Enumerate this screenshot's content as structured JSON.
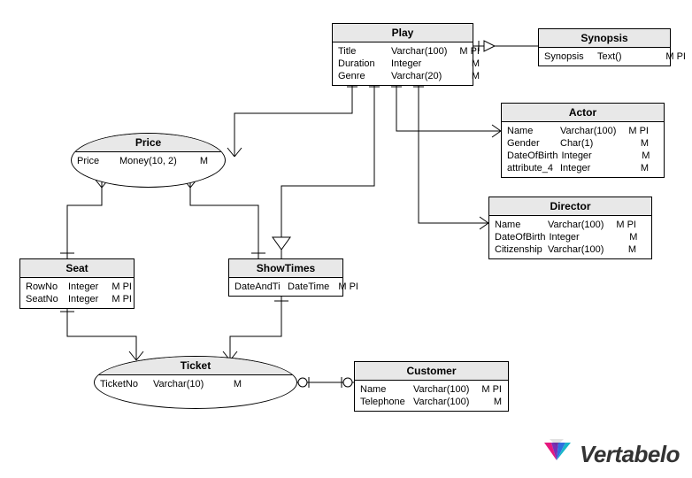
{
  "entities": {
    "play": {
      "title": "Play",
      "rows": [
        {
          "name": "Title",
          "type": "Varchar(100)",
          "flags": "M PI"
        },
        {
          "name": "Duration",
          "type": "Integer",
          "flags": "M"
        },
        {
          "name": "Genre",
          "type": "Varchar(20)",
          "flags": "M"
        }
      ]
    },
    "synopsis": {
      "title": "Synopsis",
      "rows": [
        {
          "name": "Synopsis",
          "type": "Text()",
          "flags": "M PI"
        }
      ]
    },
    "actor": {
      "title": "Actor",
      "rows": [
        {
          "name": "Name",
          "type": "Varchar(100)",
          "flags": "M PI"
        },
        {
          "name": "Gender",
          "type": "Char(1)",
          "flags": "M"
        },
        {
          "name": "DateOfBirth",
          "type": "Integer",
          "flags": "M"
        },
        {
          "name": "attribute_4",
          "type": "Integer",
          "flags": "M"
        }
      ]
    },
    "director": {
      "title": "Director",
      "rows": [
        {
          "name": "Name",
          "type": "Varchar(100)",
          "flags": "M PI"
        },
        {
          "name": "DateOfBirth",
          "type": "Integer",
          "flags": "M"
        },
        {
          "name": "Citizenship",
          "type": "Varchar(100)",
          "flags": "M"
        }
      ]
    },
    "price": {
      "title": "Price",
      "rows": [
        {
          "name": "Price",
          "type": "Money(10, 2)",
          "flags": "M"
        }
      ]
    },
    "seat": {
      "title": "Seat",
      "rows": [
        {
          "name": "RowNo",
          "type": "Integer",
          "flags": "M PI"
        },
        {
          "name": "SeatNo",
          "type": "Integer",
          "flags": "M PI"
        }
      ]
    },
    "showtimes": {
      "title": "ShowTimes",
      "rows": [
        {
          "name": "DateAndTi",
          "type": "DateTime",
          "flags": "M PI"
        }
      ]
    },
    "ticket": {
      "title": "Ticket",
      "rows": [
        {
          "name": "TicketNo",
          "type": "Varchar(10)",
          "flags": "M"
        }
      ]
    },
    "customer": {
      "title": "Customer",
      "rows": [
        {
          "name": "Name",
          "type": "Varchar(100)",
          "flags": "M PI"
        },
        {
          "name": "Telephone",
          "type": "Varchar(100)",
          "flags": "M"
        }
      ]
    }
  },
  "logo": "Vertabelo"
}
